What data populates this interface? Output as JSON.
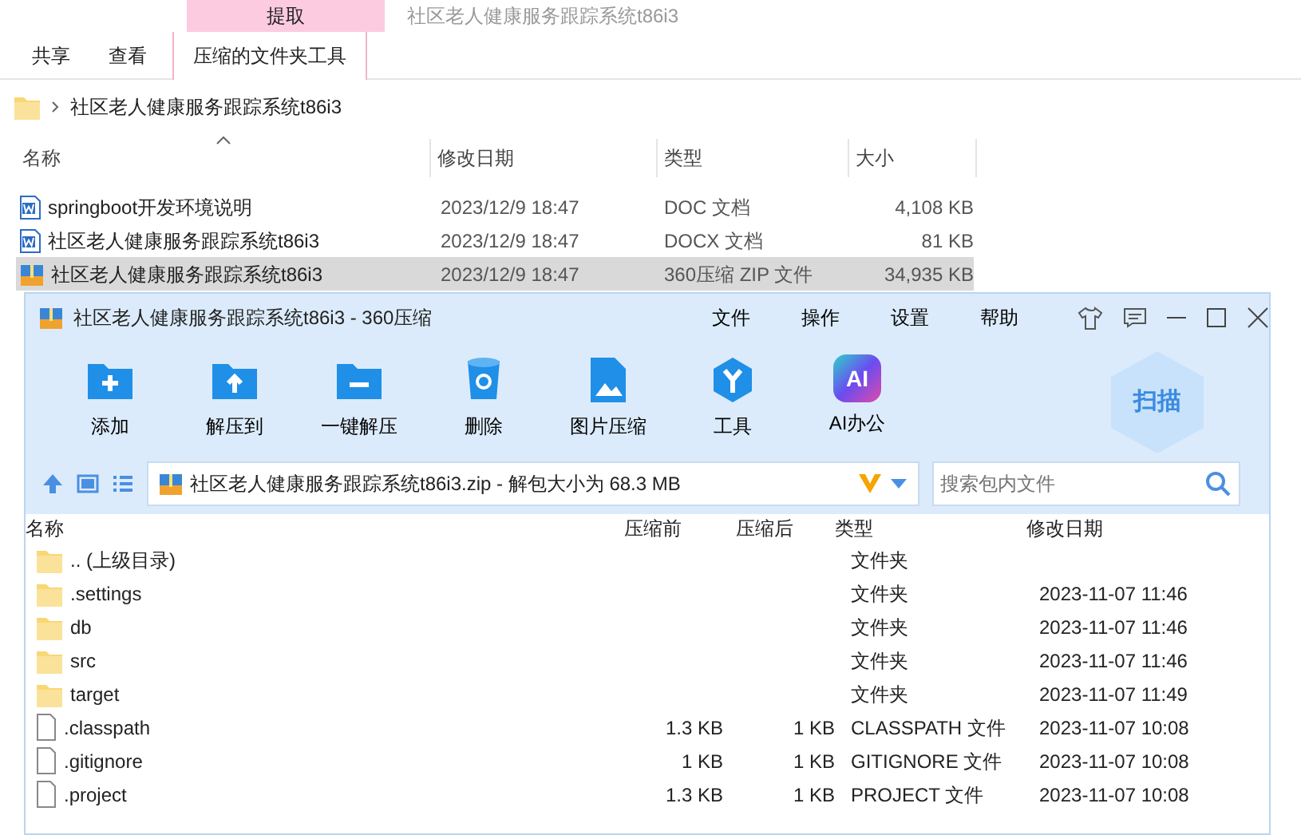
{
  "explorer": {
    "ribbon": {
      "context_label": "提取",
      "title": "社区老人健康服务跟踪系统t86i3",
      "tabs": [
        {
          "label": "共享",
          "selected": false
        },
        {
          "label": "查看",
          "selected": false
        },
        {
          "label": "压缩的文件夹工具",
          "selected": true
        }
      ]
    },
    "address": {
      "crumb": "社区老人健康服务跟踪系统t86i3"
    },
    "columns": [
      "名称",
      "修改日期",
      "类型",
      "大小"
    ],
    "files": [
      {
        "name": "springboot开发环境说明",
        "kind": "word",
        "date": "2023/12/9 18:47",
        "type": "DOC 文档",
        "size": "4,108 KB",
        "selected": false
      },
      {
        "name": "社区老人健康服务跟踪系统t86i3",
        "kind": "word",
        "date": "2023/12/9 18:47",
        "type": "DOCX 文档",
        "size": "81 KB",
        "selected": false
      },
      {
        "name": "社区老人健康服务跟踪系统t86i3",
        "kind": "zip",
        "date": "2023/12/9 18:47",
        "type": "360压缩 ZIP 文件",
        "size": "34,935 KB",
        "selected": true
      }
    ]
  },
  "zip_window": {
    "title": "社区老人健康服务跟踪系统t86i3 - 360压缩",
    "menu": [
      "文件",
      "操作",
      "设置",
      "帮助"
    ],
    "toolbar": [
      {
        "label": "添加",
        "kind": "add"
      },
      {
        "label": "解压到",
        "kind": "extract"
      },
      {
        "label": "一键解压",
        "kind": "oneclick"
      },
      {
        "label": "删除",
        "kind": "delete"
      },
      {
        "label": "图片压缩",
        "kind": "image"
      },
      {
        "label": "工具",
        "kind": "tools"
      },
      {
        "label": "AI办公",
        "kind": "ai",
        "icon_text": "AI"
      }
    ],
    "scan_label": "扫描",
    "path": "社区老人健康服务跟踪系统t86i3.zip - 解包大小为 68.3 MB",
    "search": {
      "placeholder": "搜索包内文件"
    },
    "columns": [
      "名称",
      "压缩前",
      "压缩后",
      "类型",
      "修改日期"
    ],
    "rows": [
      {
        "name": ".. (上级目录)",
        "kind": "folder",
        "type": "文件夹"
      },
      {
        "name": ".settings",
        "kind": "folder",
        "type": "文件夹",
        "date": "2023-11-07 11:46"
      },
      {
        "name": "db",
        "kind": "folder",
        "type": "文件夹",
        "date": "2023-11-07 11:46"
      },
      {
        "name": "src",
        "kind": "folder",
        "type": "文件夹",
        "date": "2023-11-07 11:46"
      },
      {
        "name": "target",
        "kind": "folder",
        "type": "文件夹",
        "date": "2023-11-07 11:49"
      },
      {
        "name": ".classpath",
        "kind": "file",
        "before": "1.3 KB",
        "after": "1 KB",
        "type": "CLASSPATH 文件",
        "date": "2023-11-07 10:08"
      },
      {
        "name": ".gitignore",
        "kind": "file",
        "before": "1 KB",
        "after": "1 KB",
        "type": "GITIGNORE 文件",
        "date": "2023-11-07 10:08"
      },
      {
        "name": ".project",
        "kind": "file",
        "before": "1.3 KB",
        "after": "1 KB",
        "type": "PROJECT 文件",
        "date": "2023-11-07 10:08"
      }
    ]
  }
}
